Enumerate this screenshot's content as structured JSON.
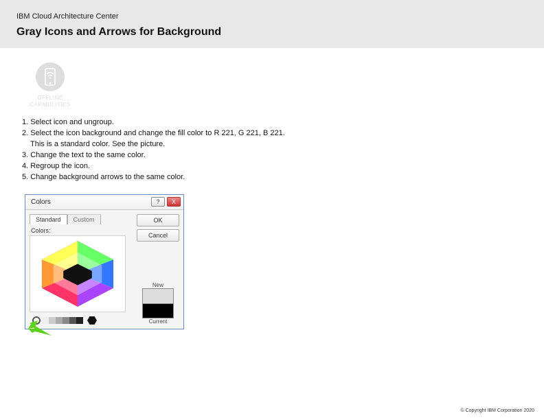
{
  "header": {
    "org": "IBM Cloud Architecture Center",
    "title": "Gray Icons and Arrows for Background"
  },
  "icon": {
    "label_line1": "OFFLINE",
    "label_line2": "CAPABILITIES"
  },
  "instructions": {
    "i1": "1. Select icon and ungroup.",
    "i2": "2. Select the icon background and change the fill color to R 221, G 221, B 221.",
    "i2b": "This is a standard color. See the picture.",
    "i3": "3. Change the text to the same color.",
    "i4": "4. Regroup the icon.",
    "i5": "5. Change background arrows to the same color."
  },
  "dialog": {
    "title": "Colors",
    "help_glyph": "?",
    "close_glyph": "X",
    "tab_standard": "Standard",
    "tab_custom": "Custom",
    "colors_label": "Colors:",
    "ok": "OK",
    "cancel": "Cancel",
    "new_label": "New",
    "current_label": "Current"
  },
  "footer": {
    "copyright": "© Copyright IBM Corporation 2020"
  }
}
